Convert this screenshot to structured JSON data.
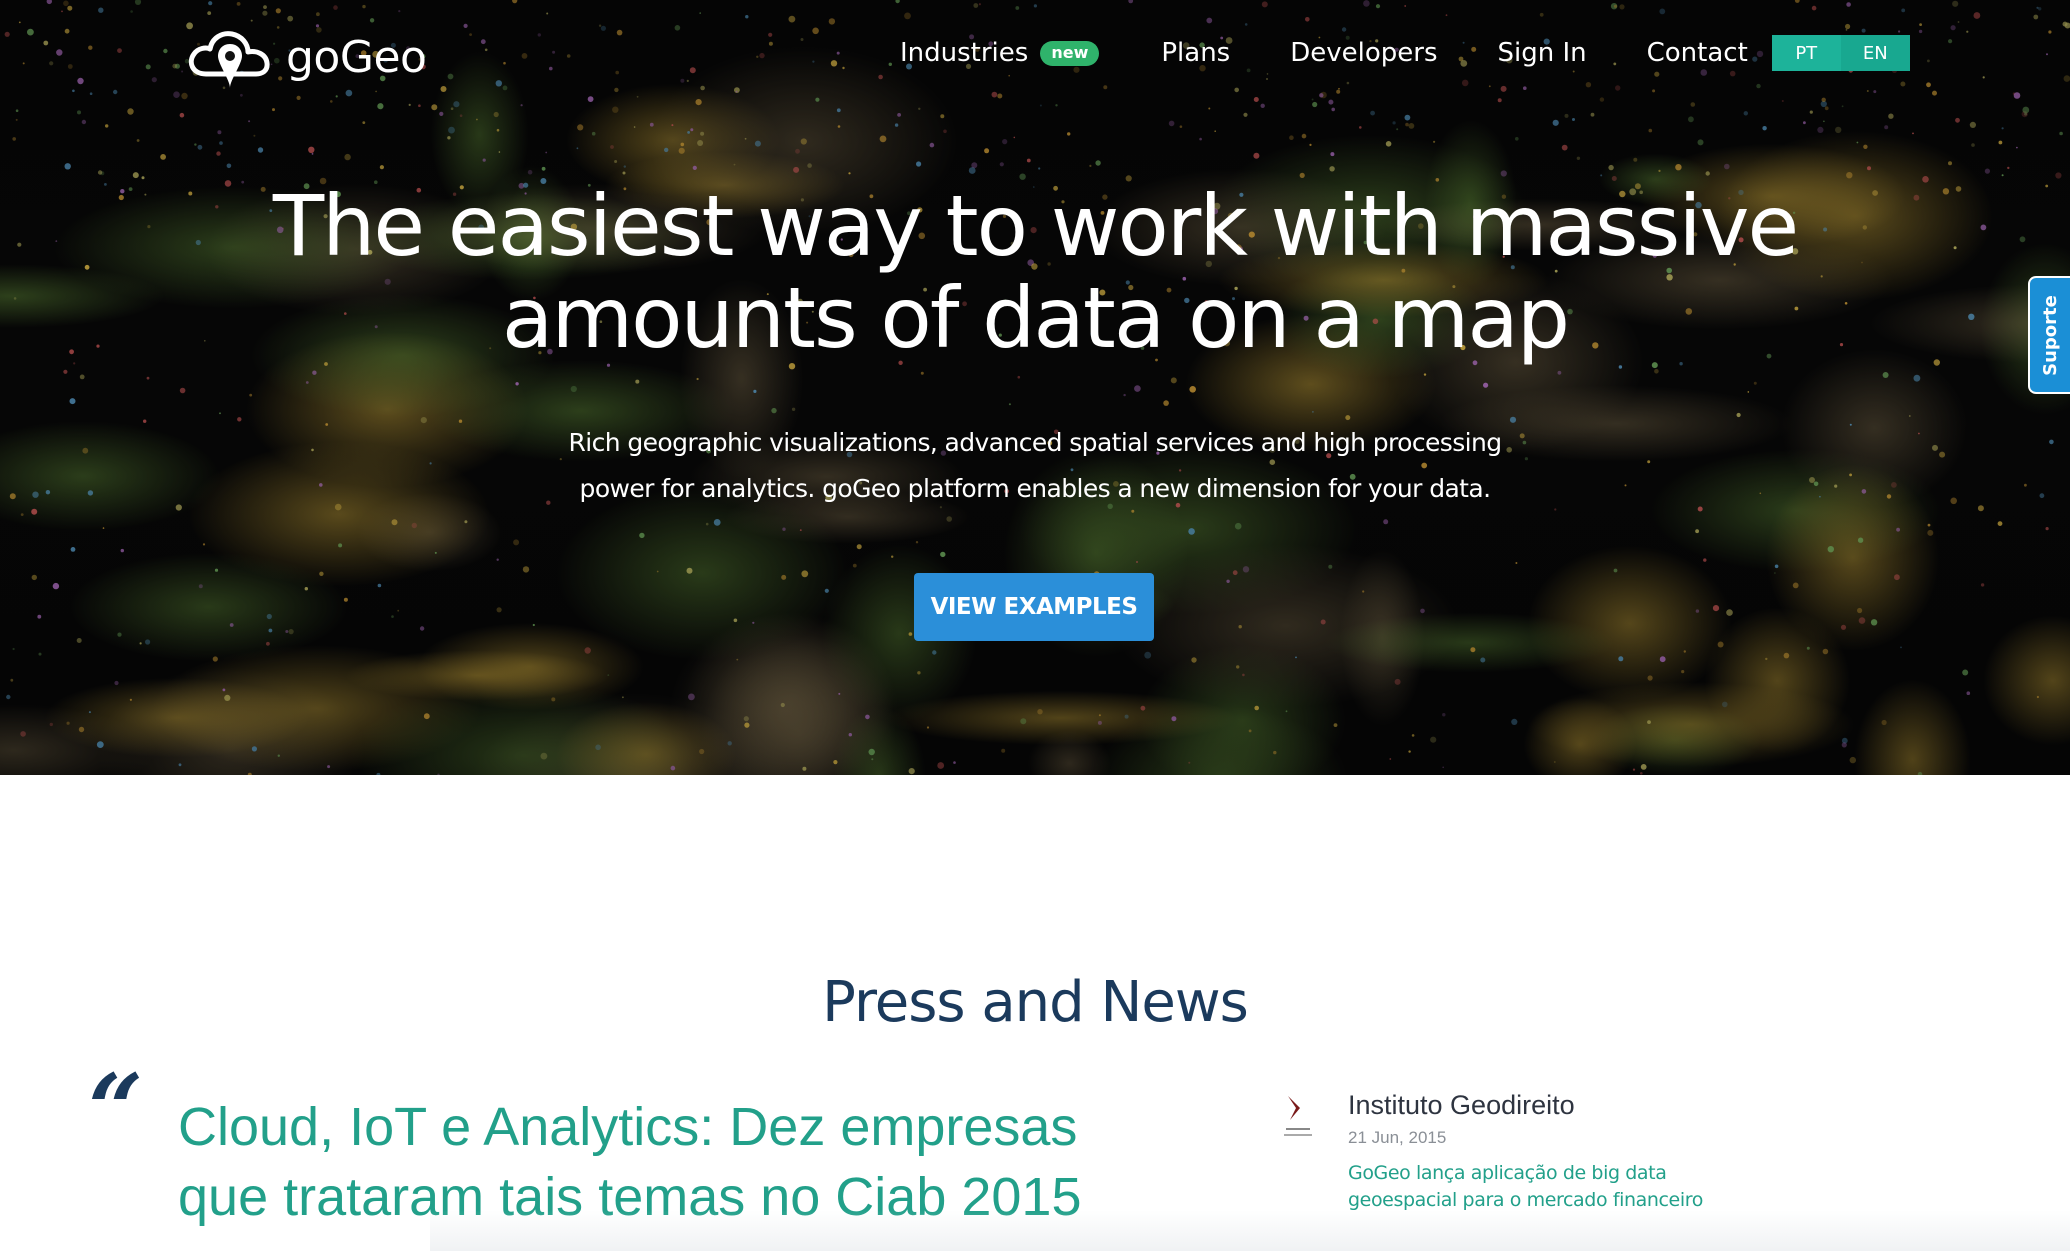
{
  "brand": {
    "name": "goGeo",
    "logo_icon": "cloud-pin-icon"
  },
  "nav": {
    "items": [
      {
        "label": "Industries",
        "badge": "new"
      },
      {
        "label": "Plans"
      },
      {
        "label": "Developers"
      },
      {
        "label": "Sign In"
      },
      {
        "label": "Contact"
      }
    ],
    "languages": [
      "PT",
      "EN"
    ]
  },
  "hero": {
    "title_line1": "The easiest way to work with massive",
    "title_line2": "amounts of data on a map",
    "subtitle": "Rich geographic visualizations, advanced spatial services and high processing power for analytics. goGeo platform enables a new dimension for your data.",
    "cta_label": "VIEW EXAMPLES"
  },
  "support_tab": {
    "label": "Suporte"
  },
  "press": {
    "section_title": "Press and News",
    "quote_mark": "“",
    "featured_headline": "Cloud, IoT e Analytics: Dez empresas que trataram tais temas no Ciab 2015",
    "news_card": {
      "source": "Instituto Geodireito",
      "date": "21 Jun, 2015",
      "link_text": "GoGeo lança aplicação de big data geoespacial para o mercado financeiro"
    }
  },
  "colors": {
    "accent_green": "#22a08a",
    "cta_blue": "#2b8fd9",
    "navy": "#1b3a5c",
    "lang_teal": "#1db39a",
    "badge_green": "#2fb36b"
  }
}
